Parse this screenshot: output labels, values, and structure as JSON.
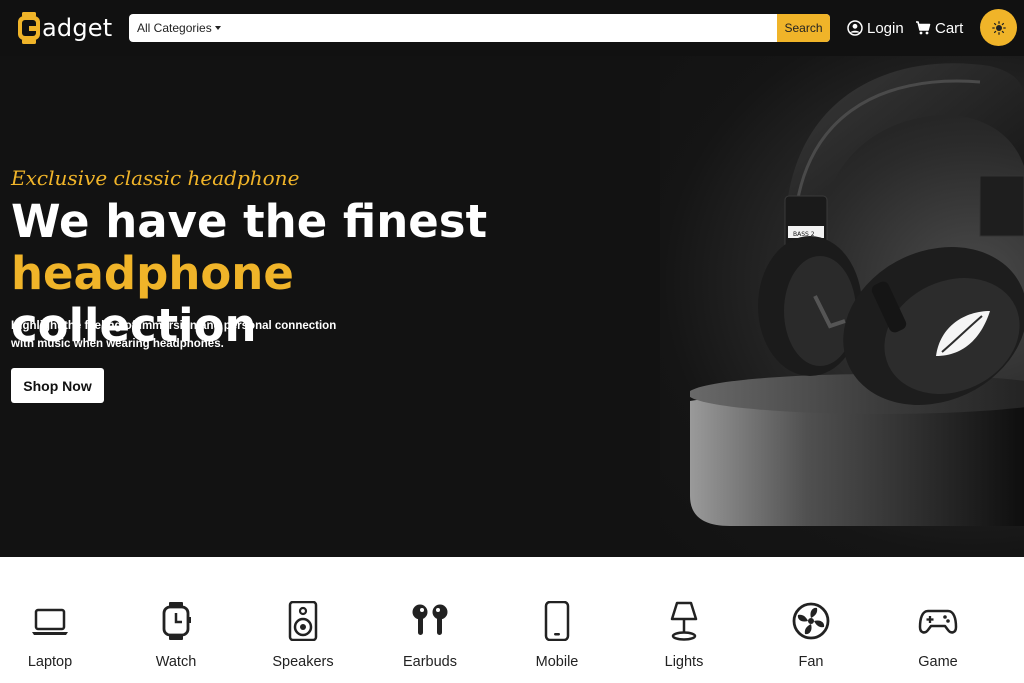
{
  "header": {
    "logo_text": "adget",
    "logo_letter": "G",
    "search": {
      "category_label": "All Categories",
      "placeholder": "",
      "button_label": "Search"
    },
    "login_label": "Login",
    "cart_label": "Cart",
    "theme_icon": "sun-icon"
  },
  "hero": {
    "tagline": "Exclusive classic headphone",
    "headline_part1": "We have the finest ",
    "headline_accent": "headphone",
    "headline_part2": "collection",
    "subtext": "Highlight the feeling of immersion and personal connection with music when wearing headphones.",
    "cta_label": "Shop Now",
    "image_label": "BASS 2"
  },
  "categories": [
    {
      "label": "Laptop",
      "icon": "laptop-icon"
    },
    {
      "label": "Watch",
      "icon": "watch-icon"
    },
    {
      "label": "Speakers",
      "icon": "speaker-icon"
    },
    {
      "label": "Earbuds",
      "icon": "earbuds-icon"
    },
    {
      "label": "Mobile",
      "icon": "mobile-icon"
    },
    {
      "label": "Lights",
      "icon": "lamp-icon"
    },
    {
      "label": "Fan",
      "icon": "fan-icon"
    },
    {
      "label": "Game",
      "icon": "gamepad-icon"
    }
  ],
  "colors": {
    "accent": "#f0b429",
    "header_bg": "#111111",
    "hero_bg": "#121212"
  }
}
